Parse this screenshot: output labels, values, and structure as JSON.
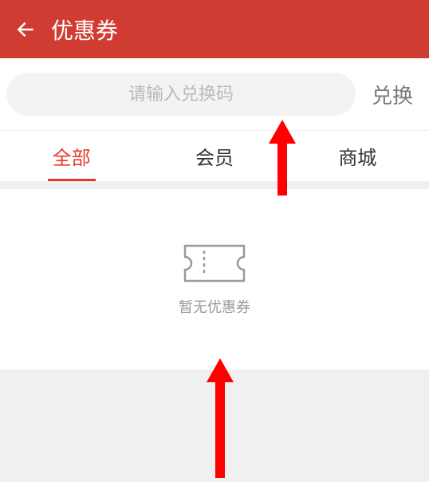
{
  "header": {
    "title": "优惠券"
  },
  "redeem": {
    "placeholder": "请输入兑换码",
    "button_label": "兑换"
  },
  "tabs": {
    "items": [
      {
        "label": "全部",
        "active": true
      },
      {
        "label": "会员",
        "active": false
      },
      {
        "label": "商城",
        "active": false
      }
    ]
  },
  "empty": {
    "text": "暂无优惠券"
  },
  "colors": {
    "primary": "#d03c32",
    "accent": "#e23b2e"
  }
}
